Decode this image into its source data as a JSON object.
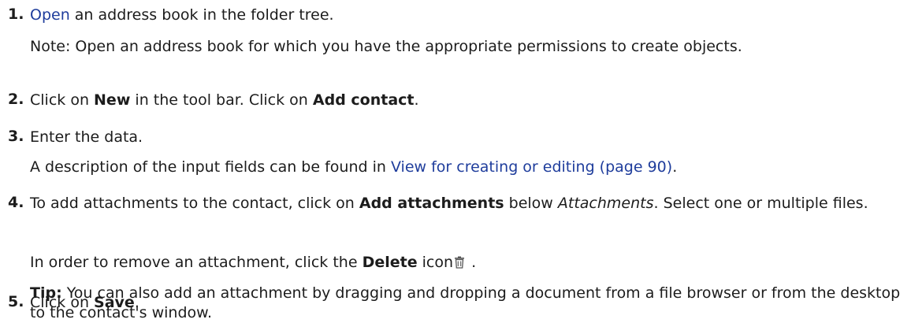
{
  "steps": [
    {
      "number": "1.",
      "link": "Open",
      "text": " an address book in the folder tree.",
      "note": "Note:  Open an address book for which you have the appropriate permissions to create objects."
    },
    {
      "number": "2.",
      "pre": "Click on ",
      "bold1": "New",
      "mid": " in the tool bar. Click on ",
      "bold2": "Add contact",
      "post": "."
    },
    {
      "number": "3.",
      "text": "Enter the data.",
      "desc_pre": "A description of the input fields can be found in ",
      "desc_link": "View for creating or editing (page 90)",
      "desc_post": "."
    },
    {
      "number": "4.",
      "pre": "To add attachments to the contact, click on ",
      "bold": "Add attachments",
      "mid": " below ",
      "italic": "Attachments",
      "post": ". Select one or multiple files.",
      "remove_pre": "In order to remove an attachment, click the ",
      "remove_bold": "Delete",
      "remove_post": " icon",
      "remove_end": " .",
      "remove_icon": "trash-icon",
      "tip_label": "Tip:",
      "tip_text": " You can also add an attachment by dragging and dropping a document from a file browser or from the desktop to the contact's window."
    },
    {
      "number": "5.",
      "pre": "Click on ",
      "bold": "Save",
      "post": "."
    }
  ],
  "colors": {
    "link": "#1f3d9c",
    "text": "#1c1c1c"
  }
}
